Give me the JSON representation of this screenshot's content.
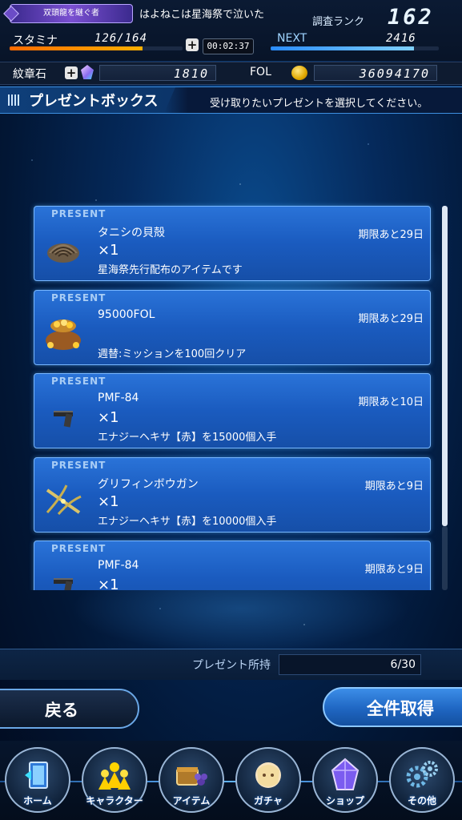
{
  "header": {
    "title_badge": "双頭龍を継ぐ者",
    "player_name": "はよねこは星海祭で泣いた",
    "rank_label": "調査ランク",
    "rank_value": "162",
    "stamina_label": "スタミナ",
    "stamina_value": "126/164",
    "stamina_fraction": 0.768,
    "timer": "00:02:37",
    "next_label": "NEXT",
    "next_value": "2416",
    "next_fraction": 0.85
  },
  "currency": {
    "emblem_label": "紋章石",
    "emblem_value": "1810",
    "fol_label": "FOL",
    "fol_value": "36094170"
  },
  "section": {
    "title": "プレゼントボックス",
    "subtitle": "受け取りたいプレゼントを選択してください。"
  },
  "presents": [
    {
      "tag": "PRESENT",
      "name": "タニシの貝殻",
      "qty": "×1",
      "expiry": "期限あと29日",
      "desc": "星海祭先行配布のアイテムです",
      "icon": "shell-icon"
    },
    {
      "tag": "PRESENT",
      "name": "95000FOL",
      "qty": "",
      "expiry": "期限あと29日",
      "desc": "週替:ミッションを100回クリア",
      "icon": "gold-bag-icon"
    },
    {
      "tag": "PRESENT",
      "name": "PMF-84",
      "qty": "×1",
      "expiry": "期限あと10日",
      "desc": "エナジーヘキサ【赤】を15000個入手",
      "icon": "pistol-icon"
    },
    {
      "tag": "PRESENT",
      "name": "グリフィンボウガン",
      "qty": "×1",
      "expiry": "期限あと9日",
      "desc": "エナジーヘキサ【赤】を10000個入手",
      "icon": "crossbow-icon"
    },
    {
      "tag": "PRESENT",
      "name": "PMF-84",
      "qty": "×1",
      "expiry": "期限あと9日",
      "desc": "",
      "icon": "pistol-icon"
    }
  ],
  "footer": {
    "count_label": "プレゼント所持",
    "count_value": "6/30",
    "back_label": "戻る",
    "claim_all_label": "全件取得"
  },
  "nav": [
    {
      "label": "ホーム",
      "icon": "home-icon"
    },
    {
      "label": "キャラクター",
      "icon": "character-icon"
    },
    {
      "label": "アイテム",
      "icon": "item-icon"
    },
    {
      "label": "ガチャ",
      "icon": "gacha-icon"
    },
    {
      "label": "ショップ",
      "icon": "shop-icon"
    },
    {
      "label": "その他",
      "icon": "settings-icon"
    }
  ],
  "colors": {
    "accent": "#2a73d8",
    "stamina": "#ff8a00",
    "next": "#4aa8ff"
  }
}
